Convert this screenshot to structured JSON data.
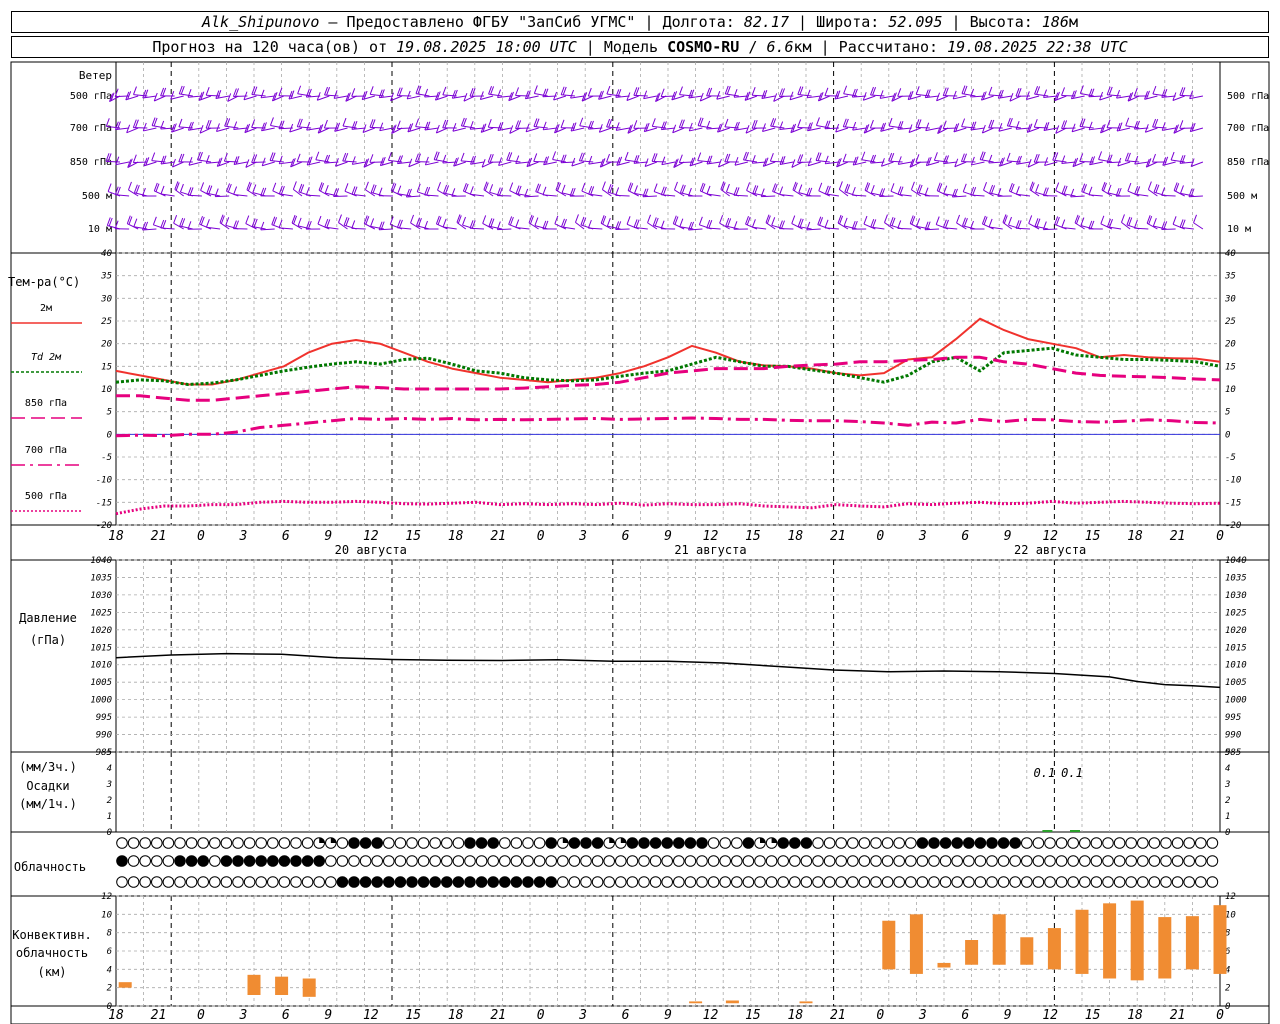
{
  "header": {
    "station": "Alk_Shipunovo",
    "provider": " – Предоставлено ФГБУ \"ЗапСиб УГМС\" | ",
    "lon_label": "Долгота: ",
    "lon": "82.17",
    "lat_label": " | Широта: ",
    "lat": "52.095",
    "alt_label": " | Высота: ",
    "alt": "186",
    "alt_unit": "м",
    "forecast_label": "Прогноз на 120 часа(ов) от ",
    "forecast_start": "19.08.2025 18:00 UTC",
    "model_label": "  | Модель ",
    "model": "COSMO-RU",
    "resolution_sep": " / ",
    "resolution": "6.6",
    "resolution_unit": "км",
    "calc_label": " | Рассчитано: ",
    "calc_time": "19.08.2025 22:38 UTC"
  },
  "colors": {
    "wind": "#7b00d4",
    "t2m": "#f0322d",
    "td2m": "#007800",
    "t850": "#e6007e",
    "t700": "#e6007e",
    "t500": "#e6007e",
    "pressure": "#000000",
    "precip": "#2aa02a",
    "convective": "#f08c32",
    "zero_line": "#3232dc",
    "grid": "#aaaaaa"
  },
  "chart_data": {
    "type": "meteogram",
    "time_axis": {
      "tick_labels": [
        "18",
        "21",
        "0",
        "3",
        "6",
        "9",
        "12",
        "15",
        "18",
        "21",
        "0",
        "3",
        "6",
        "9",
        "12",
        "15",
        "18",
        "21",
        "0",
        "3",
        "6",
        "9",
        "12",
        "15",
        "18",
        "21",
        "0"
      ],
      "date_labels": [
        {
          "text": "20 августа",
          "tick": 6
        },
        {
          "text": "21 августа",
          "tick": 14
        },
        {
          "text": "22 августа",
          "tick": 22
        }
      ]
    },
    "wind": {
      "title": "Ветер",
      "levels": [
        "500 гПа",
        "700 гПа",
        "850 гПа",
        "500 м",
        "10  м"
      ],
      "right_levels": [
        "500 гПа",
        "700 гПа",
        "850 гПа",
        "500 м",
        "10  м"
      ]
    },
    "temperature": {
      "title": "Тем-ра(°С)",
      "ylim": [
        -20,
        40
      ],
      "ticks": [
        "-20",
        "-15",
        "-10",
        "-5",
        "0",
        "5",
        "10",
        "15",
        "20",
        "25",
        "30",
        "35",
        "40"
      ],
      "legend": [
        {
          "key": "t2m",
          "label": "2м"
        },
        {
          "key": "td2m",
          "label": "Td  2м"
        },
        {
          "key": "t850",
          "label": "850 гПа"
        },
        {
          "key": "t700",
          "label": "700 гПа"
        },
        {
          "key": "t500",
          "label": "500 гПа"
        }
      ],
      "hours": [
        0,
        3,
        6,
        9,
        12,
        15,
        18,
        21,
        24,
        27,
        30,
        33,
        36,
        39,
        42,
        45,
        48,
        51,
        54,
        57,
        60,
        63,
        66,
        69,
        72,
        75,
        78,
        81,
        84,
        87,
        90,
        93,
        96,
        99,
        102,
        105,
        108,
        111,
        114,
        117,
        120
      ],
      "series": [
        {
          "key": "t2m",
          "values": [
            14,
            13,
            12,
            11,
            11,
            12,
            13.5,
            15,
            18,
            20,
            20.8,
            20,
            18,
            16,
            14.5,
            13.5,
            12.5,
            12,
            11.5,
            12,
            12.5,
            13.5,
            15,
            17,
            19.5,
            18,
            16,
            15.2,
            15,
            14.5,
            13.5,
            13,
            13.5,
            16.5,
            17,
            21,
            25.5,
            23,
            21,
            20,
            19,
            17,
            17.5,
            17,
            16.8,
            16.7,
            16
          ]
        },
        {
          "key": "td2m",
          "values": [
            11.5,
            12,
            11.8,
            11,
            11.3,
            12,
            13,
            14,
            14.8,
            15.5,
            16,
            15.5,
            16.5,
            16.8,
            15.5,
            14,
            13.5,
            12.5,
            12,
            11.8,
            12,
            12.8,
            13.5,
            14,
            15.5,
            17,
            16,
            15,
            15,
            14.2,
            13.5,
            12.5,
            11.5,
            13,
            16,
            17,
            14,
            18,
            18.5,
            19,
            17.5,
            17,
            16.5,
            16.5,
            16.3,
            16,
            15
          ]
        },
        {
          "key": "t850",
          "values": [
            8.5,
            8.5,
            8,
            7.5,
            7.5,
            8,
            8.5,
            9,
            9.5,
            10,
            10.5,
            10.3,
            10,
            10,
            10,
            10,
            10,
            10.2,
            10.5,
            10.8,
            11,
            11.5,
            12.5,
            13.5,
            14,
            14.5,
            14.5,
            14.5,
            15,
            15.3,
            15.5,
            16,
            16,
            16.3,
            16.5,
            17,
            17,
            16,
            15.5,
            14.5,
            13.5,
            13,
            12.8,
            12.7,
            12.5,
            12.2,
            12
          ]
        },
        {
          "key": "t700",
          "values": [
            -0.3,
            -0.2,
            -0.3,
            0,
            0,
            0.5,
            1.5,
            2,
            2.5,
            3,
            3.5,
            3.3,
            3.5,
            3.3,
            3.5,
            3.2,
            3.3,
            3.2,
            3.3,
            3.4,
            3.5,
            3.3,
            3.4,
            3.5,
            3.6,
            3.5,
            3.3,
            3.3,
            3.1,
            3,
            3,
            2.8,
            2.5,
            2,
            2.7,
            2.5,
            3.3,
            2.8,
            3.3,
            3.2,
            2.8,
            2.7,
            2.9,
            3.2,
            3,
            2.6,
            2.5
          ]
        },
        {
          "key": "t500",
          "values": [
            -17.5,
            -16.5,
            -15.8,
            -15.8,
            -15.5,
            -15.5,
            -15,
            -14.8,
            -15,
            -15,
            -14.8,
            -15,
            -15.3,
            -15.4,
            -15.2,
            -15,
            -15.5,
            -15.3,
            -15.5,
            -15.3,
            -15.5,
            -15.2,
            -15.6,
            -15.3,
            -15.5,
            -15.5,
            -15.3,
            -15.8,
            -16,
            -16.2,
            -15.5,
            -15.8,
            -16,
            -15.3,
            -15.5,
            -15.2,
            -15,
            -15.3,
            -15.2,
            -14.8,
            -15.2,
            -15,
            -14.8,
            -15,
            -15.2,
            -15.3,
            -15.2
          ]
        }
      ]
    },
    "pressure": {
      "title": "Давление",
      "unit": "(гПа)",
      "ylim": [
        985,
        1040
      ],
      "ticks": [
        "985",
        "990",
        "995",
        "1000",
        "1005",
        "1010",
        "1015",
        "1020",
        "1025",
        "1030",
        "1035",
        "1040"
      ],
      "hours": [
        0,
        6,
        12,
        18,
        24,
        30,
        36,
        42,
        48,
        54,
        60,
        66,
        72,
        78,
        84,
        90,
        96,
        102,
        108,
        111,
        114,
        117,
        120
      ],
      "values": [
        1012,
        1012.8,
        1013.2,
        1013,
        1012,
        1011.5,
        1011.3,
        1011.2,
        1011.4,
        1011,
        1011,
        1010.5,
        1009.5,
        1008.5,
        1008,
        1008.2,
        1008,
        1007.5,
        1006.5,
        1005.2,
        1004.3,
        1004,
        1003.5
      ]
    },
    "precipitation": {
      "unit_3h": "(мм/3ч.)",
      "title": "Осадки",
      "unit_1h": "(мм/1ч.)",
      "ylim": [
        0,
        5
      ],
      "ticks": [
        "0",
        "1",
        "2",
        "3",
        "4",
        "5"
      ],
      "labels": [
        {
          "text": "0.1",
          "hour": 102
        },
        {
          "text": "0.1",
          "hour": 105
        }
      ]
    },
    "cloudiness": {
      "title": "Облачность",
      "rows": [
        "000000000000000002201110000000111000012111221111111000122111000000000111111111000000000000000000000011111111111111111111111111111111",
        "100001110111111111000000000000000000000000000000000000000000000000000000000000000000000000000000000111111111111111111111111111111111",
        "000000000000000000011111111111111111110000000000000000000000000000000000000000000000000000000000000000000000000001111111111111111111"
      ]
    },
    "convective": {
      "title": "Конвективн.",
      "subtitle": "облачность",
      "unit": "(км)",
      "ylim": [
        0,
        12
      ],
      "ticks": [
        "0",
        "2",
        "4",
        "6",
        "8",
        "10",
        "12"
      ],
      "bars": [
        {
          "h": 1,
          "base": 2,
          "top": 2.6
        },
        {
          "h": 15,
          "base": 1.2,
          "top": 3.4
        },
        {
          "h": 18,
          "base": 1.2,
          "top": 3.2
        },
        {
          "h": 21,
          "base": 1,
          "top": 3
        },
        {
          "h": 63,
          "base": 0.3,
          "top": 0.5
        },
        {
          "h": 67,
          "base": 0.3,
          "top": 0.6
        },
        {
          "h": 75,
          "base": 0.3,
          "top": 0.5
        },
        {
          "h": 84,
          "base": 4,
          "top": 9.3
        },
        {
          "h": 87,
          "base": 3.5,
          "top": 10
        },
        {
          "h": 90,
          "base": 4.2,
          "top": 4.7
        },
        {
          "h": 93,
          "base": 4.5,
          "top": 7.2
        },
        {
          "h": 96,
          "base": 4.5,
          "top": 10
        },
        {
          "h": 99,
          "base": 4.5,
          "top": 7.5
        },
        {
          "h": 102,
          "base": 4,
          "top": 8.5
        },
        {
          "h": 105,
          "base": 3.5,
          "top": 10.5
        },
        {
          "h": 108,
          "base": 3,
          "top": 11.2
        },
        {
          "h": 111,
          "base": 2.8,
          "top": 11.5
        },
        {
          "h": 114,
          "base": 3,
          "top": 9.7
        },
        {
          "h": 117,
          "base": 4,
          "top": 9.8
        },
        {
          "h": 120,
          "base": 3.5,
          "top": 11
        }
      ]
    }
  }
}
